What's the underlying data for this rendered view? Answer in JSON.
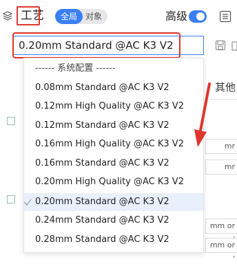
{
  "header": {
    "title": "工艺",
    "seg_on": "全局",
    "seg_off": "对象",
    "advanced_label": "高级"
  },
  "preset": {
    "selected": "0.20mm Standard @AC K3 V2"
  },
  "dropdown": {
    "items": [
      "------ 系统配置 ------",
      "0.08mm Standard @AC K3 V2",
      "0.12mm High Quality @AC K3 V2",
      "0.12mm Standard @AC K3 V2",
      "0.16mm High Quality @AC K3 V2",
      "0.16mm Standard @AC K3 V2",
      "0.20mm High Quality @AC K3 V2",
      "0.20mm Standard @AC K3 V2",
      "0.24mm Standard @AC K3 V2",
      "0.28mm Standard @AC K3 V2"
    ],
    "selected_index": 7
  },
  "background": {
    "tab_other": "其他",
    "unit1": "mr",
    "unit2": "mr",
    "unit3": "mm or '",
    "unit4": "mm or '"
  },
  "colors": {
    "accent": "#3b7ff5",
    "annotation": "#e0352b"
  },
  "icons": {
    "header": "layers-icon",
    "list": "list-icon",
    "save": "save-icon",
    "check": "check-icon",
    "arrow": "red-arrow-annotation"
  }
}
